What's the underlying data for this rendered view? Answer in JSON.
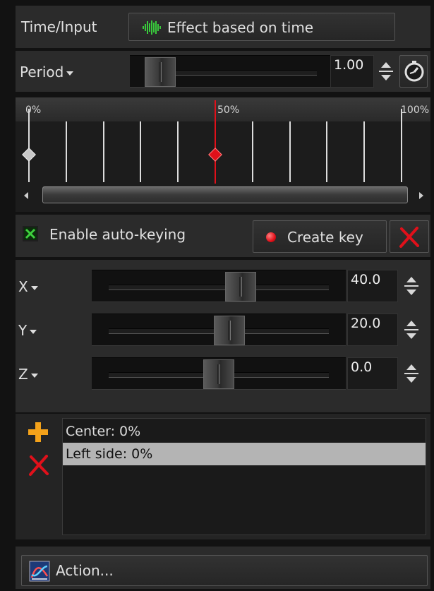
{
  "time_input": {
    "label": "Time/Input",
    "effect_button": "Effect based on time"
  },
  "period": {
    "label": "Period",
    "value": "1.00",
    "slider_fraction": 0.08
  },
  "timeline": {
    "labels": [
      "0%",
      "50%",
      "100%"
    ],
    "keyframes": [
      0.0,
      0.5
    ],
    "current_fraction": 0.5
  },
  "autokey": {
    "label": "Enable auto-keying",
    "checked": true,
    "create_key_label": "Create key"
  },
  "axes": [
    {
      "name": "X",
      "value": "40.0",
      "slider_fraction": 0.6
    },
    {
      "name": "Y",
      "value": "20.0",
      "slider_fraction": 0.55
    },
    {
      "name": "Z",
      "value": "0.0",
      "slider_fraction": 0.5
    }
  ],
  "keys_list": {
    "items": [
      "Center:  0%",
      "Left side:  0%"
    ],
    "selected_index": 1
  },
  "action": {
    "label": "Action..."
  },
  "colors": {
    "accent_red": "#e0101a",
    "effect_icon": "#39c83c",
    "selected_row": "#b4b4b4"
  }
}
